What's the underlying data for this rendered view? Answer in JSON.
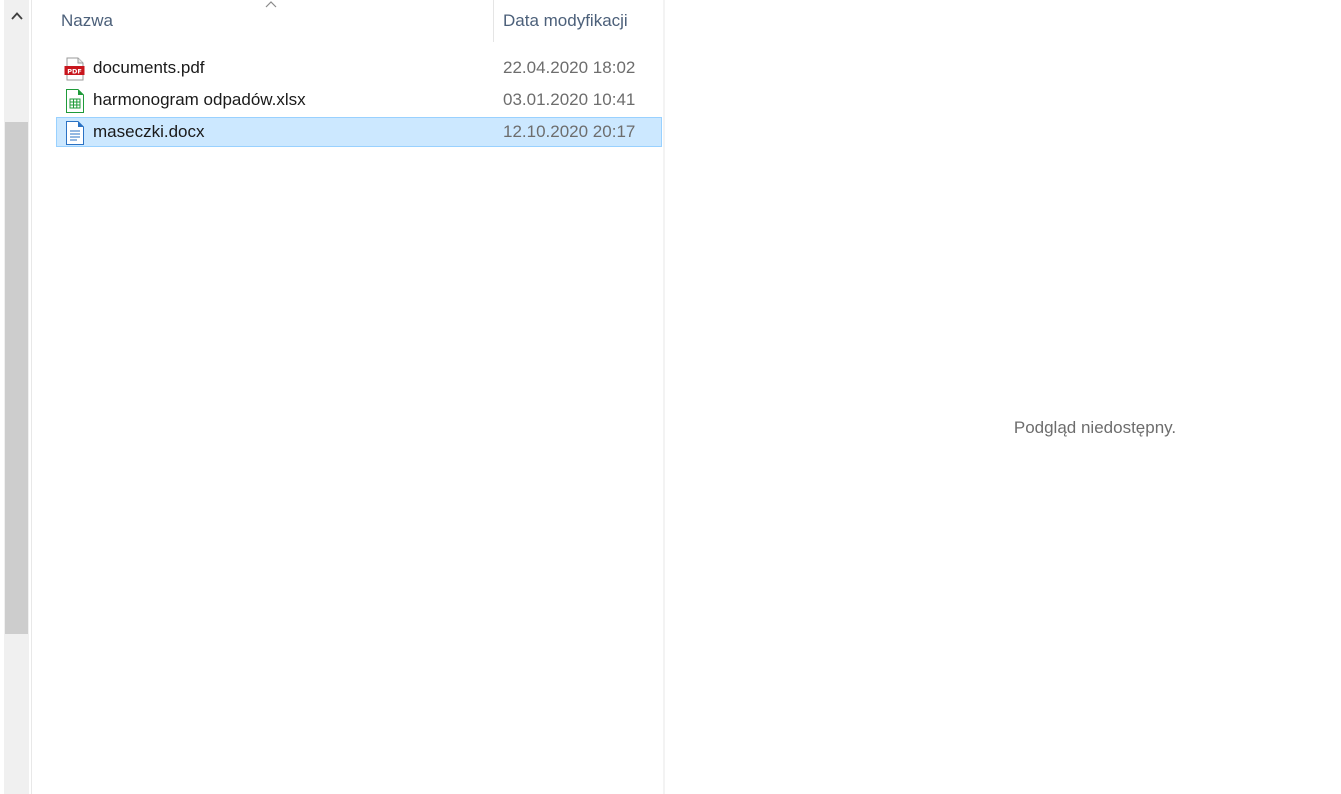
{
  "nav_pane": {
    "scroll_up_icon": "chevron-up-icon"
  },
  "file_list": {
    "columns": {
      "name": "Nazwa",
      "date_modified": "Data modyfikacji"
    },
    "sort_indicator_icon": "sort-ascending-caret-icon",
    "files": [
      {
        "name": "documents.pdf",
        "date_modified": "22.04.2020 18:02",
        "icon": "pdf-file-icon",
        "selected": false
      },
      {
        "name": "harmonogram odpadów.xlsx",
        "date_modified": "03.01.2020 10:41",
        "icon": "spreadsheet-file-icon",
        "selected": false
      },
      {
        "name": "maseczki.docx",
        "date_modified": "12.10.2020 20:17",
        "icon": "document-file-icon",
        "selected": true
      }
    ]
  },
  "preview_pane": {
    "message": "Podgląd niedostępny."
  },
  "colors": {
    "selection_background": "#cce8ff",
    "selection_border": "#99d1ff",
    "header_text": "#4c607a",
    "pdf_red": "#c8161d",
    "spreadsheet_green": "#1f9b3a",
    "document_blue": "#2a72c4"
  }
}
